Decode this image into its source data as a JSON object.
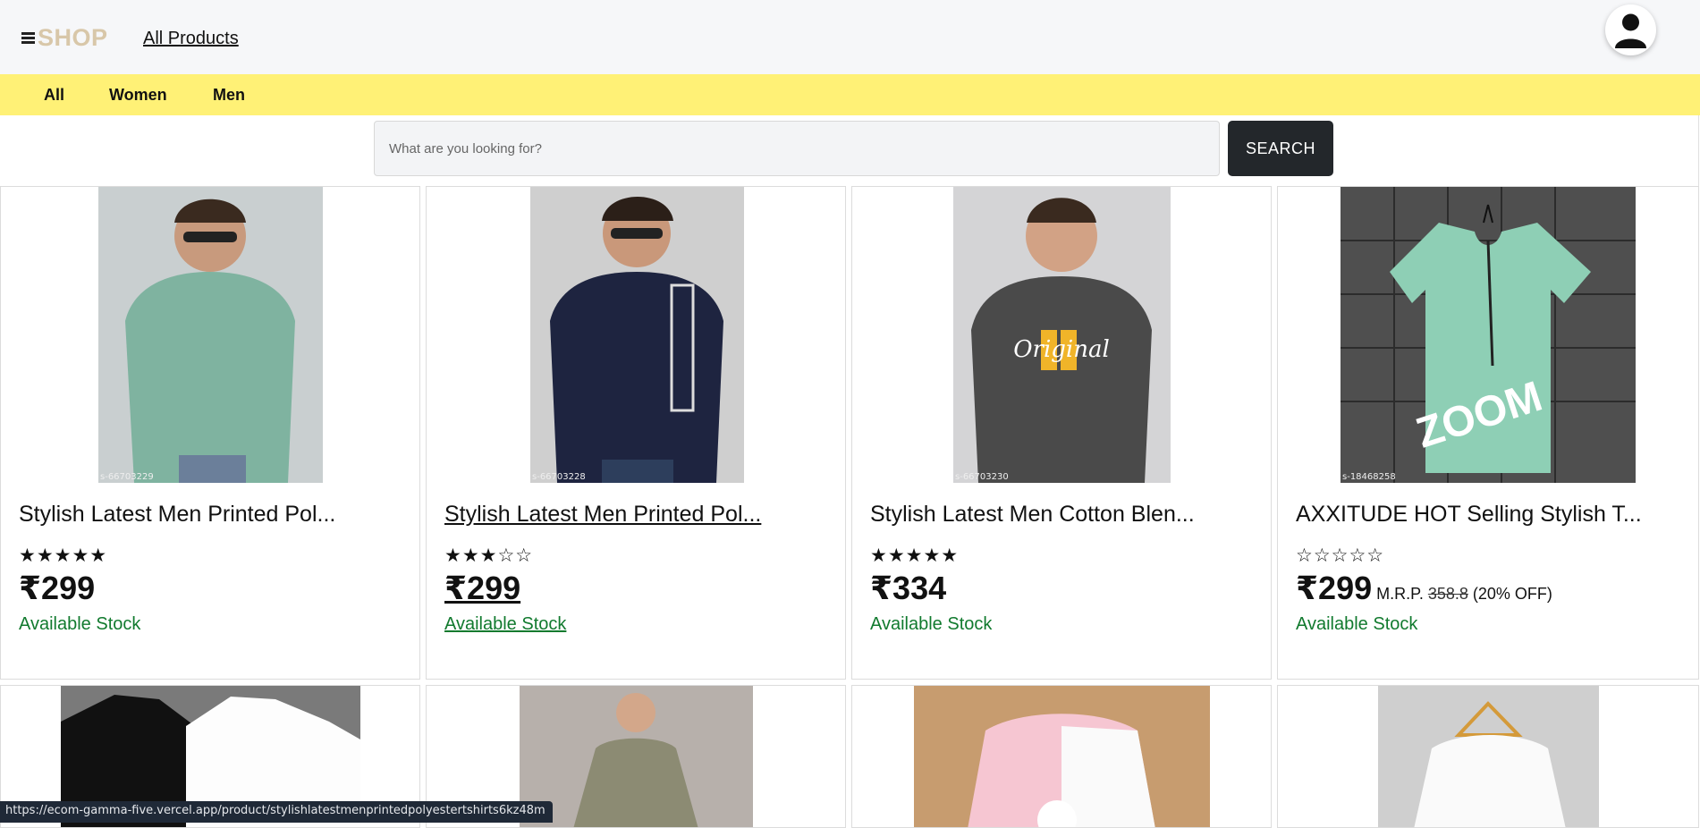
{
  "header": {
    "logo_text": "SHOP",
    "nav_link": "All Products"
  },
  "categories": [
    "All",
    "Women",
    "Men"
  ],
  "search": {
    "placeholder": "What are you looking for?",
    "button_label": "SEARCH"
  },
  "products": [
    {
      "title": "Stylish Latest Men Printed Pol...",
      "rating": 5,
      "stars": "★★★★★",
      "price": "₹299",
      "mrp_label": "",
      "mrp_value": "",
      "discount": "",
      "stock": "Available Stock",
      "image_code": "s-66703229",
      "image_color": "#7fb3a0"
    },
    {
      "title": "Stylish Latest Men Printed Pol...",
      "rating": 3,
      "stars": "★★★☆☆",
      "price": "₹299",
      "mrp_label": "",
      "mrp_value": "",
      "discount": "",
      "stock": "Available Stock",
      "image_code": "s-66703228",
      "image_color": "#1e2440"
    },
    {
      "title": "Stylish Latest Men Cotton Blen...",
      "rating": 5,
      "stars": "★★★★★",
      "price": "₹334",
      "mrp_label": "",
      "mrp_value": "",
      "discount": "",
      "stock": "Available Stock",
      "image_code": "s-66703230",
      "image_color": "#4a4a4a"
    },
    {
      "title": "AXXITUDE HOT Selling Stylish T...",
      "rating": 0,
      "stars": "☆☆☆☆☆",
      "price": "₹299",
      "mrp_label": "M.R.P.",
      "mrp_value": "358.8",
      "discount": "(20% OFF)",
      "stock": "Available Stock",
      "image_code": "s-18468258",
      "image_color": "#8ecfb5"
    }
  ],
  "status_url": "https://ecom-gamma-five.vercel.app/product/stylishlatestmenprintedpolyestertshirts6kz48m",
  "colors": {
    "category_bar": "#fff176",
    "search_button": "#23272b",
    "stock_text": "#117a2e",
    "logo_text": "#d8c7a9"
  }
}
